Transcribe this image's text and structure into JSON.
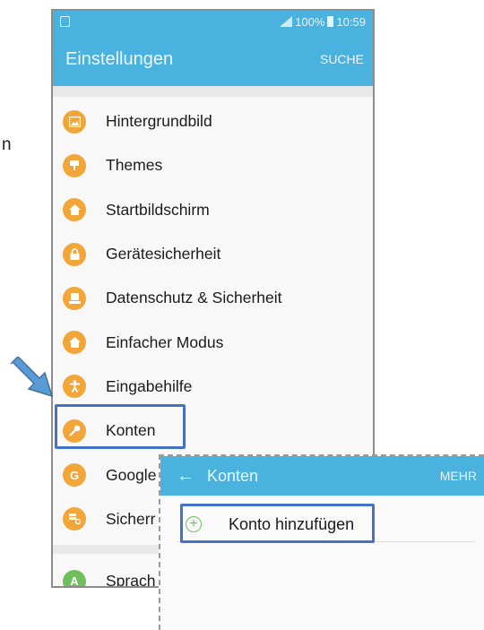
{
  "stray_text": "n",
  "status_bar": {
    "battery": "100%",
    "time": "10:59"
  },
  "app_bar": {
    "title": "Einstellungen",
    "action": "SUCHE"
  },
  "settings_items": [
    {
      "label": "Hintergrundbild",
      "icon": "wallpaper-icon"
    },
    {
      "label": "Themes",
      "icon": "themes-brush-icon"
    },
    {
      "label": "Startbildschirm",
      "icon": "home-icon"
    },
    {
      "label": "Gerätesicherheit",
      "icon": "lock-icon"
    },
    {
      "label": "Datenschutz & Sicherheit",
      "icon": "privacy-icon"
    },
    {
      "label": "Einfacher Modus",
      "icon": "easy-mode-icon"
    },
    {
      "label": "Eingabehilfe",
      "icon": "accessibility-icon"
    },
    {
      "label": "Konten",
      "icon": "key-icon"
    },
    {
      "label": "Google",
      "icon": "google-icon"
    },
    {
      "label": "Sicherr",
      "icon": "backup-icon"
    },
    {
      "label": "Sprach",
      "icon": "language-icon"
    }
  ],
  "overlay": {
    "title": "Konten",
    "action": "MEHR",
    "add_account_label": "Konto hinzufügen"
  },
  "colors": {
    "accent_bar": "#4ab2df",
    "icon_orange": "#f2a63a",
    "icon_green": "#6fbf5f",
    "highlight": "#4472c4"
  }
}
